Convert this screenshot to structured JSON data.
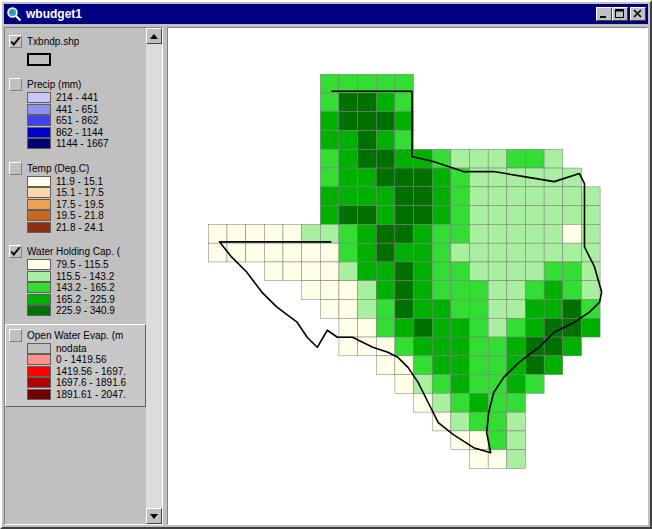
{
  "window": {
    "title": "wbudget1"
  },
  "legend": [
    {
      "label": "Txbndp.shp",
      "checked": true,
      "active": false,
      "kind": "outline",
      "items": []
    },
    {
      "label": "Precip (mm)",
      "checked": false,
      "active": false,
      "kind": "ramp",
      "items": [
        {
          "label": "214 - 441",
          "color": "#c8c8f8"
        },
        {
          "label": "441 - 651",
          "color": "#9090f0"
        },
        {
          "label": "651 - 862",
          "color": "#4040f0"
        },
        {
          "label": "862 - 1144",
          "color": "#0000c8"
        },
        {
          "label": "1144 - 1667",
          "color": "#000070"
        }
      ]
    },
    {
      "label": "Temp (Deg.C)",
      "checked": false,
      "active": false,
      "kind": "ramp",
      "items": [
        {
          "label": "11.9 - 15.1",
          "color": "#fffff0"
        },
        {
          "label": "15.1 - 17.5",
          "color": "#ffd8a8"
        },
        {
          "label": "17.5 - 19.5",
          "color": "#f0a050"
        },
        {
          "label": "19.5 - 21.8",
          "color": "#c86820"
        },
        {
          "label": "21.8 - 24.1",
          "color": "#8c3010"
        }
      ]
    },
    {
      "label": "Water Holding Cap. (",
      "checked": true,
      "active": false,
      "kind": "ramp",
      "items": [
        {
          "label": "79.5 - 115.5",
          "color": "#ffffe8"
        },
        {
          "label": "115.5 - 143.2",
          "color": "#a8f0a0"
        },
        {
          "label": "143.2 - 165.2",
          "color": "#33dd33"
        },
        {
          "label": "165.2 - 225.9",
          "color": "#00b000"
        },
        {
          "label": "225.9 - 340.9",
          "color": "#007000"
        }
      ]
    },
    {
      "label": "Open Water Evap. (m",
      "checked": false,
      "active": true,
      "kind": "ramp",
      "items": [
        {
          "label": "nodata",
          "color": "#c0c0c0"
        },
        {
          "label": "0 - 1419.56",
          "color": "#ff9090"
        },
        {
          "label": "1419.56 - 1697.",
          "color": "#ff0000"
        },
        {
          "label": "1697.6 - 1891.6",
          "color": "#b00000"
        },
        {
          "label": "1891.61 - 2047.",
          "color": "#700000"
        }
      ]
    }
  ],
  "map": {
    "cells": [
      [
        0,
        0,
        0,
        0,
        0,
        0,
        3,
        3,
        3,
        3,
        3,
        0,
        0,
        0,
        0,
        0,
        0,
        0,
        0,
        0,
        0
      ],
      [
        0,
        0,
        0,
        0,
        0,
        0,
        3,
        5,
        5,
        4,
        3,
        0,
        0,
        0,
        0,
        0,
        0,
        0,
        0,
        0,
        0
      ],
      [
        0,
        0,
        0,
        0,
        0,
        0,
        4,
        5,
        5,
        5,
        4,
        0,
        0,
        0,
        0,
        0,
        0,
        0,
        0,
        0,
        0
      ],
      [
        0,
        0,
        0,
        0,
        0,
        0,
        4,
        4,
        5,
        4,
        3,
        0,
        0,
        0,
        0,
        0,
        0,
        0,
        0,
        0,
        0
      ],
      [
        0,
        0,
        0,
        0,
        0,
        0,
        3,
        4,
        5,
        5,
        4,
        4,
        3,
        2,
        2,
        2,
        3,
        3,
        2,
        0,
        0
      ],
      [
        0,
        0,
        0,
        0,
        0,
        0,
        3,
        4,
        4,
        5,
        5,
        5,
        4,
        3,
        2,
        2,
        2,
        2,
        2,
        2,
        0
      ],
      [
        0,
        0,
        0,
        0,
        0,
        0,
        4,
        4,
        4,
        4,
        5,
        5,
        4,
        3,
        2,
        2,
        2,
        2,
        2,
        2,
        2
      ],
      [
        0,
        0,
        0,
        0,
        0,
        0,
        4,
        5,
        5,
        4,
        5,
        5,
        4,
        3,
        2,
        2,
        2,
        2,
        2,
        2,
        2
      ],
      [
        1,
        1,
        1,
        1,
        1,
        2,
        2,
        3,
        4,
        5,
        5,
        4,
        3,
        3,
        2,
        2,
        2,
        2,
        2,
        1,
        2
      ],
      [
        1,
        1,
        1,
        1,
        1,
        1,
        1,
        3,
        4,
        5,
        4,
        4,
        3,
        2,
        2,
        2,
        2,
        2,
        2,
        2,
        2
      ],
      [
        0,
        0,
        0,
        1,
        1,
        1,
        1,
        2,
        4,
        4,
        5,
        4,
        3,
        3,
        2,
        2,
        2,
        2,
        3,
        3,
        2
      ],
      [
        0,
        0,
        0,
        0,
        0,
        1,
        1,
        1,
        2,
        4,
        5,
        4,
        3,
        3,
        3,
        2,
        2,
        3,
        4,
        3,
        2
      ],
      [
        0,
        0,
        0,
        0,
        0,
        0,
        1,
        1,
        2,
        3,
        5,
        4,
        4,
        3,
        3,
        2,
        2,
        4,
        4,
        5,
        3
      ],
      [
        0,
        0,
        0,
        0,
        0,
        0,
        0,
        1,
        1,
        3,
        4,
        5,
        4,
        4,
        3,
        2,
        3,
        4,
        5,
        5,
        4
      ],
      [
        0,
        0,
        0,
        0,
        0,
        0,
        0,
        1,
        1,
        1,
        3,
        4,
        4,
        4,
        3,
        3,
        4,
        5,
        5,
        4,
        0
      ],
      [
        0,
        0,
        0,
        0,
        0,
        0,
        0,
        0,
        0,
        1,
        1,
        3,
        4,
        4,
        3,
        3,
        4,
        5,
        4,
        0,
        0
      ],
      [
        0,
        0,
        0,
        0,
        0,
        0,
        0,
        0,
        0,
        0,
        1,
        2,
        3,
        4,
        3,
        3,
        4,
        3,
        0,
        0,
        0
      ],
      [
        0,
        0,
        0,
        0,
        0,
        0,
        0,
        0,
        0,
        0,
        0,
        1,
        2,
        3,
        4,
        3,
        3,
        0,
        0,
        0,
        0
      ],
      [
        0,
        0,
        0,
        0,
        0,
        0,
        0,
        0,
        0,
        0,
        0,
        0,
        1,
        2,
        3,
        3,
        2,
        0,
        0,
        0,
        0
      ],
      [
        0,
        0,
        0,
        0,
        0,
        0,
        0,
        0,
        0,
        0,
        0,
        0,
        0,
        1,
        1,
        3,
        2,
        0,
        0,
        0,
        0
      ],
      [
        0,
        0,
        0,
        0,
        0,
        0,
        0,
        0,
        0,
        0,
        0,
        0,
        0,
        0,
        1,
        1,
        2,
        0,
        0,
        0,
        0
      ]
    ]
  }
}
